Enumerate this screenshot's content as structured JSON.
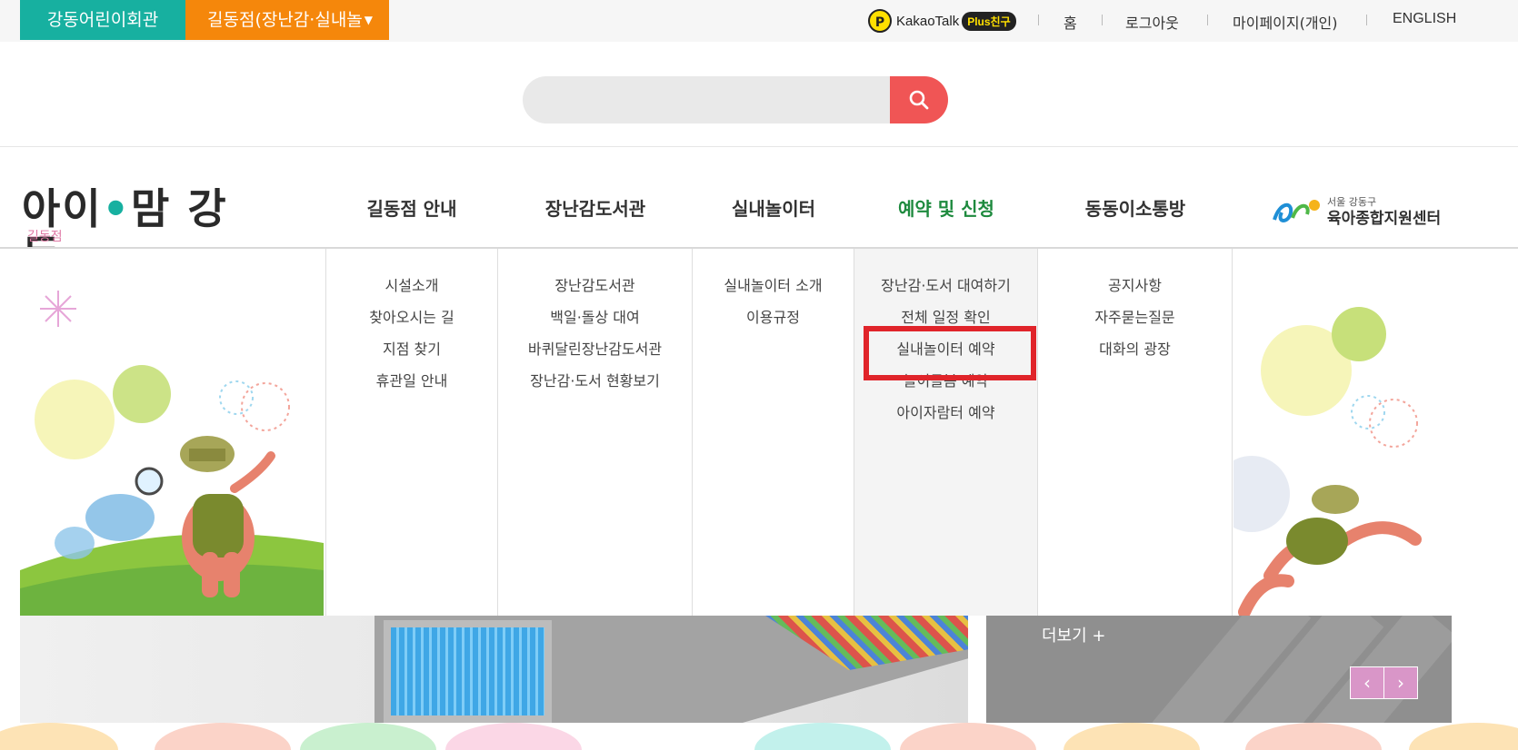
{
  "topbar": {
    "main_site": "강동어린이회관",
    "branch_site": "길동점(장난감·실내놀",
    "kakao_label": "KakaoTalk",
    "kakao_plus": "Plus친구",
    "links": [
      "홈",
      "로그아웃",
      "마이페이지(개인)",
      "ENGLISH"
    ]
  },
  "search": {
    "placeholder": ""
  },
  "logo": {
    "title": "아이·맘 강동",
    "title_left": "아이",
    "title_right": "맘 강동",
    "subtitle": "길동점"
  },
  "nav": {
    "items": [
      {
        "label": "길동점 안내",
        "sub": [
          "시설소개",
          "찾아오시는 길",
          "지점 찾기",
          "휴관일 안내"
        ]
      },
      {
        "label": "장난감도서관",
        "sub": [
          "장난감도서관",
          "백일·돌상 대여",
          "바퀴달린장난감도서관",
          "장난감·도서 현황보기"
        ]
      },
      {
        "label": "실내놀이터",
        "sub": [
          "실내놀이터 소개",
          "이용규정"
        ]
      },
      {
        "label": "예약 및 신청",
        "sub": [
          "장난감·도서 대여하기",
          "전체 일정 확인",
          "실내놀이터 예약",
          "놀이돌봄 예약",
          "아이자람터 예약"
        ]
      },
      {
        "label": "동동이소통방",
        "sub": [
          "공지사항",
          "자주묻는질문",
          "대화의 광장"
        ]
      }
    ],
    "active_index": 3
  },
  "partner": {
    "subtitle": "서울 강동구",
    "title": "육아종합지원센터"
  },
  "notice": {
    "more_label": "더보기 +",
    "prev": "‹",
    "next": "›"
  },
  "colors": {
    "teal": "#17b0a0",
    "orange": "#f5870b",
    "active": "#1e8a3e",
    "search_btn": "#f05555",
    "highlight": "#e0242a",
    "pager": "#d996c8"
  },
  "icons": {
    "search": "search-icon",
    "kakao": "kakao-plus-icon"
  }
}
